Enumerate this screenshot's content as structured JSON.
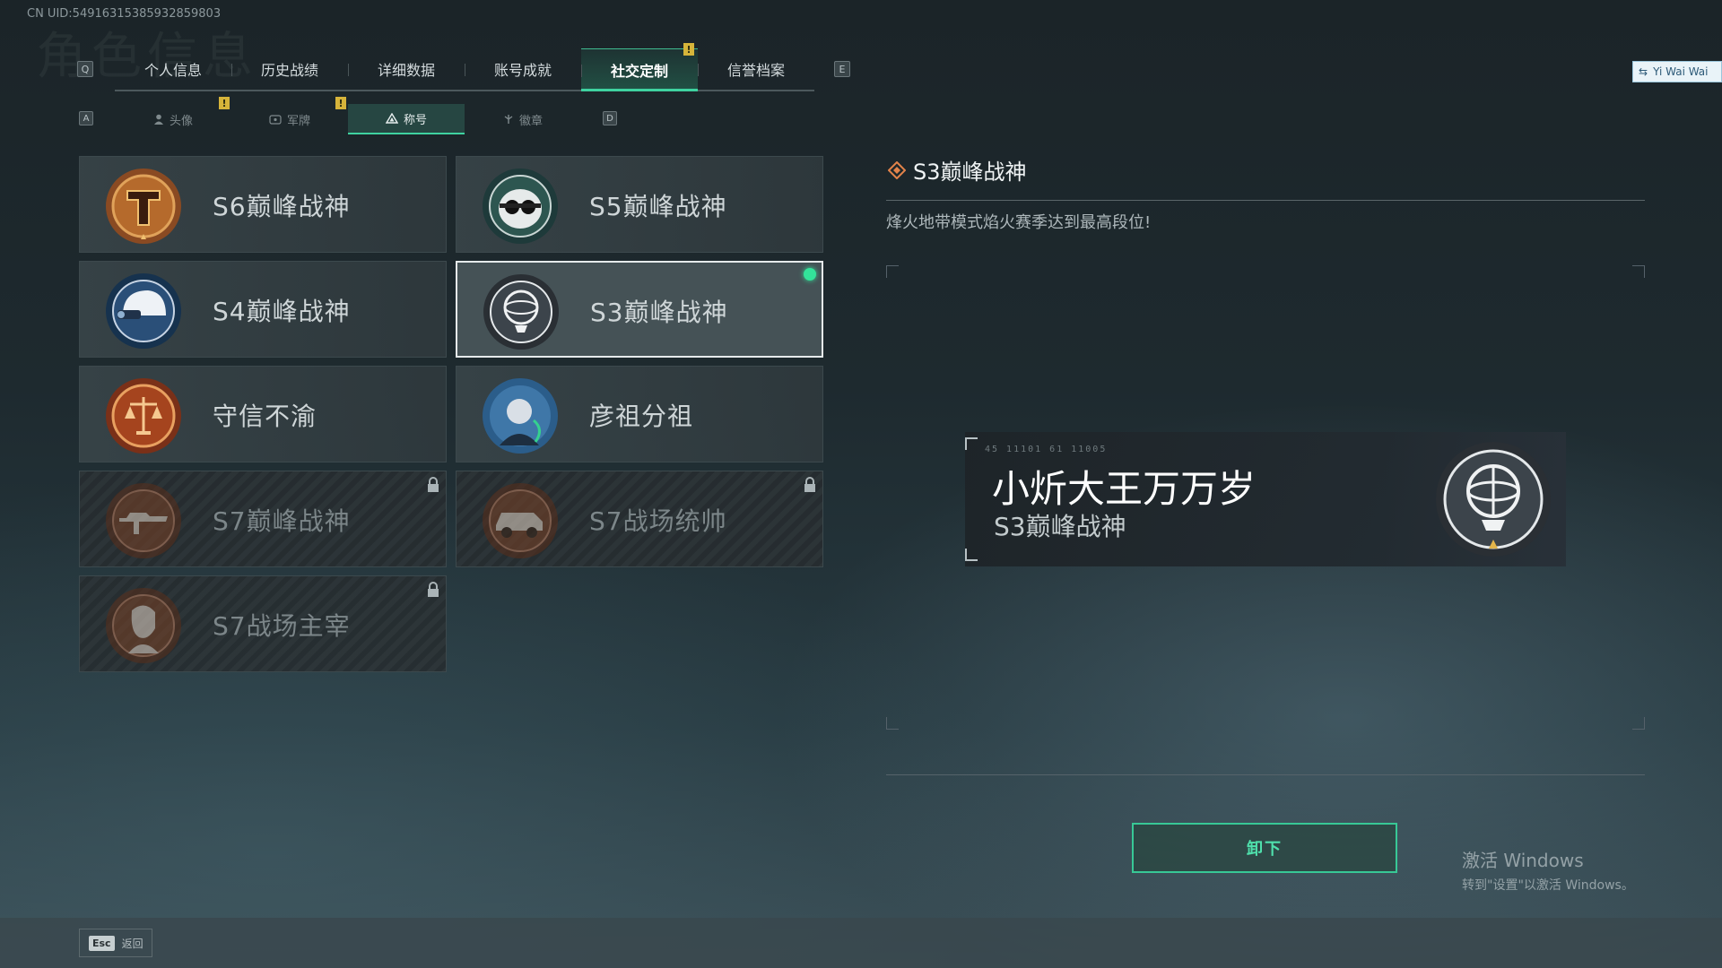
{
  "uid": "CN UID:5491631538593285980​3",
  "bg_title": "角色信息",
  "tabs": {
    "left_key": "Q",
    "right_key": "E",
    "items": [
      {
        "label": "个人信息"
      },
      {
        "label": "历史战绩"
      },
      {
        "label": "详细数据"
      },
      {
        "label": "账号成就"
      },
      {
        "label": "社交定制"
      },
      {
        "label": "信誉档案"
      }
    ],
    "notice": "!"
  },
  "subtabs": {
    "left_key": "A",
    "right_key": "D",
    "items": [
      {
        "label": "头像"
      },
      {
        "label": "军牌"
      },
      {
        "label": "称号"
      },
      {
        "label": "徽章"
      }
    ],
    "notice": "!"
  },
  "titles": [
    {
      "label": "S6巅峰战神",
      "badge": "shield-t-icon",
      "state": "owned"
    },
    {
      "label": "S5巅峰战神",
      "badge": "skull-goggles-icon",
      "state": "owned"
    },
    {
      "label": "S4巅峰战神",
      "badge": "helmet-nvg-icon",
      "state": "owned"
    },
    {
      "label": "S3巅峰战神",
      "badge": "armillary-sphere-icon",
      "state": "equipped"
    },
    {
      "label": "守信不渝",
      "badge": "scales-icon",
      "state": "owned"
    },
    {
      "label": "彦祖分祖",
      "badge": "portrait-icon",
      "state": "owned"
    },
    {
      "label": "S7巅峰战神",
      "badge": "rifle-icon",
      "state": "locked"
    },
    {
      "label": "S7战场统帅",
      "badge": "armored-car-icon",
      "state": "locked"
    },
    {
      "label": "S7战场主宰",
      "badge": "soldier-icon",
      "state": "locked"
    }
  ],
  "detail": {
    "title": "S3巅峰战神",
    "description": "烽火地带模式焰火赛季达到最高段位!"
  },
  "preview": {
    "code": "45 11101 61 11005",
    "player_name": "小炘大王万万岁",
    "title": "S3巅峰战神"
  },
  "unequip_label": "卸下",
  "watermark": {
    "line1": "激活 Windows",
    "line2": "转到\"设置\"以激活 Windows。"
  },
  "footer": {
    "esc_key": "Esc",
    "back_label": "返回"
  },
  "user_chip": "Yi Wai Wai",
  "colors": {
    "accent": "#3fd2a0",
    "equipped_dot": "#33e39a",
    "notice": "#d6b43a"
  }
}
